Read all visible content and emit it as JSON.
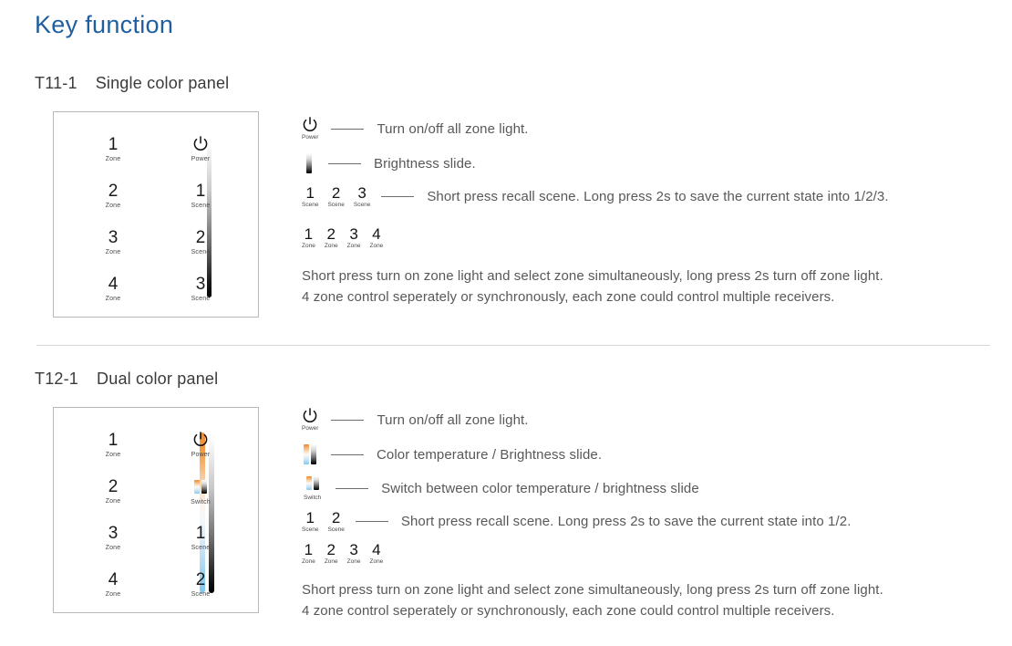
{
  "page": {
    "title": "Key function",
    "title_color": "#1f5fa0"
  },
  "sections": [
    {
      "code": "T11-1",
      "name": "Single color panel",
      "panel": {
        "left_keys": [
          {
            "num": "1",
            "cap": "Zone"
          },
          {
            "num": "2",
            "cap": "Zone"
          },
          {
            "num": "3",
            "cap": "Zone"
          },
          {
            "num": "4",
            "cap": "Zone"
          }
        ],
        "right_keys": [
          {
            "num": "",
            "cap": "Power",
            "icon": "power-icon"
          },
          {
            "num": "1",
            "cap": "Scene"
          },
          {
            "num": "2",
            "cap": "Scene"
          },
          {
            "num": "3",
            "cap": "Scene"
          }
        ],
        "sliders": [
          {
            "name": "brightness-slider",
            "type": "brightness"
          }
        ]
      },
      "legend": [
        {
          "icon": "power-icon",
          "cap": "Power",
          "text": "Turn on/off all zone light."
        },
        {
          "icon": "brightness-slide-icon",
          "cap": "",
          "text": "Brightness slide."
        },
        {
          "icon": "scene-keys",
          "keys": [
            {
              "num": "1",
              "cap": "Scene"
            },
            {
              "num": "2",
              "cap": "Scene"
            },
            {
              "num": "3",
              "cap": "Scene"
            }
          ],
          "text": "Short press recall scene. Long press 2s to save the current state into 1/2/3."
        }
      ],
      "zone_keys": [
        {
          "num": "1",
          "cap": "Zone"
        },
        {
          "num": "2",
          "cap": "Zone"
        },
        {
          "num": "3",
          "cap": "Zone"
        },
        {
          "num": "4",
          "cap": "Zone"
        }
      ],
      "paragraph_line1": "Short press turn on zone light and select zone simultaneously, long press 2s turn off zone light.",
      "paragraph_line2": "4 zone control seperately or synchronously, each zone could control multiple receivers."
    },
    {
      "code": "T12-1",
      "name": "Dual color panel",
      "panel": {
        "left_keys": [
          {
            "num": "1",
            "cap": "Zone"
          },
          {
            "num": "2",
            "cap": "Zone"
          },
          {
            "num": "3",
            "cap": "Zone"
          },
          {
            "num": "4",
            "cap": "Zone"
          }
        ],
        "right_keys": [
          {
            "num": "",
            "cap": "Power",
            "icon": "power-icon"
          },
          {
            "num": "",
            "cap": "Switch",
            "icon": "switch-icon"
          },
          {
            "num": "1",
            "cap": "Scene"
          },
          {
            "num": "2",
            "cap": "Scene"
          }
        ],
        "sliders": [
          {
            "name": "color-temperature-slider",
            "type": "cct"
          },
          {
            "name": "brightness-slider",
            "type": "brightness"
          }
        ]
      },
      "legend": [
        {
          "icon": "power-icon",
          "cap": "Power",
          "text": "Turn on/off all zone light."
        },
        {
          "icon": "cct-brightness-slide-icon",
          "cap": "",
          "text": "Color temperature / Brightness slide."
        },
        {
          "icon": "switch-icon",
          "cap": "Switch",
          "text": "Switch between color temperature / brightness slide"
        },
        {
          "icon": "scene-keys",
          "keys": [
            {
              "num": "1",
              "cap": "Scene"
            },
            {
              "num": "2",
              "cap": "Scene"
            }
          ],
          "text": "Short press recall scene. Long press 2s to save the current state into 1/2."
        }
      ],
      "zone_keys": [
        {
          "num": "1",
          "cap": "Zone"
        },
        {
          "num": "2",
          "cap": "Zone"
        },
        {
          "num": "3",
          "cap": "Zone"
        },
        {
          "num": "4",
          "cap": "Zone"
        }
      ],
      "paragraph_line1": "Short press turn on zone light and select zone simultaneously, long press 2s turn off zone light.",
      "paragraph_line2": "4 zone control seperately or synchronously, each zone could control multiple receivers."
    }
  ]
}
